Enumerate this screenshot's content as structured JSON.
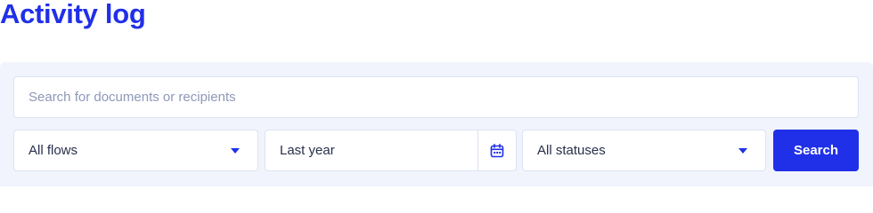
{
  "header": {
    "title": "Activity log"
  },
  "filters": {
    "search_placeholder": "Search for documents or recipients",
    "flows_selected": "All flows",
    "date_value": "Last year",
    "status_selected": "All statuses",
    "search_button_label": "Search",
    "icons": {
      "flows_dropdown": "chevron-down-icon",
      "date_picker": "calendar-icon",
      "status_dropdown": "chevron-down-icon"
    }
  },
  "colors": {
    "accent": "#2030e8",
    "panel_background": "#f1f4fc",
    "border": "#dce2f2",
    "placeholder_text": "#8e98b8",
    "body_text": "#27304a"
  }
}
